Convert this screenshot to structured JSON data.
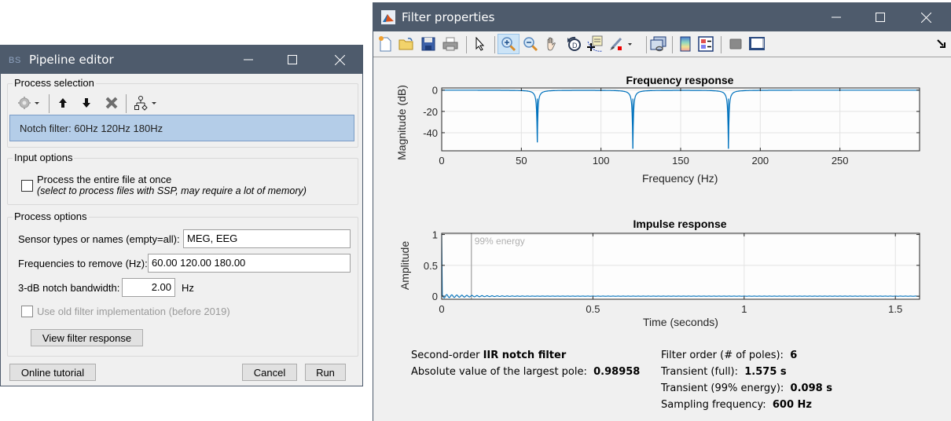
{
  "pipeline_editor": {
    "title": "Pipeline editor",
    "process_selection": {
      "label": "Process selection",
      "toolbar": [
        "gear-menu",
        "move-up",
        "move-down",
        "delete",
        "pipeline-tree"
      ],
      "selected_process": "Notch filter: 60Hz 120Hz 180Hz"
    },
    "input_options": {
      "label": "Input options",
      "entire_file_checkbox": {
        "label": "Process the entire file at once",
        "sublabel": "(select to process files with SSP, may require a lot of memory)",
        "checked": false
      }
    },
    "process_options": {
      "label": "Process options",
      "sensor_types_label": "Sensor types or names (empty=all):",
      "sensor_types_value": "MEG, EEG",
      "frequencies_label": "Frequencies to remove (Hz):",
      "frequencies_value": "60.00 120.00 180.00",
      "bandwidth_label": "3-dB notch bandwidth:",
      "bandwidth_value": "2.00",
      "bandwidth_unit": "Hz",
      "old_filter_checkbox": {
        "label": "Use old filter implementation (before 2019)",
        "checked": false,
        "enabled": false
      },
      "view_response_button": "View filter response"
    },
    "buttons": {
      "online_tutorial": "Online tutorial",
      "cancel": "Cancel",
      "run": "Run"
    }
  },
  "filter_properties": {
    "title": "Filter properties",
    "toolbar": [
      "new-figure",
      "open-file",
      "save",
      "print",
      "select-arrow",
      "zoom-in",
      "zoom-out",
      "pan",
      "rotate",
      "data-cursor",
      "brush",
      "link-plot",
      "colorbar",
      "legend",
      "hide-plot-tools",
      "show-plot-tools",
      "dock"
    ],
    "info": {
      "filter_type_prefix": "Second-order",
      "filter_type_bold": "IIR notch filter",
      "largest_pole_label": "Absolute value of the largest pole:",
      "largest_pole_value": "0.98958",
      "filter_order_label": "Filter order (# of poles):",
      "filter_order_value": "6",
      "transient_full_label": "Transient (full):",
      "transient_full_value": "1.575 s",
      "transient_99_label": "Transient (99% energy):",
      "transient_99_value": "0.098 s",
      "sampling_label": "Sampling frequency:",
      "sampling_value": "600 Hz"
    }
  },
  "chart_data": [
    {
      "type": "line",
      "title": "Frequency response",
      "xlabel": "Frequency (Hz)",
      "ylabel": "Magnitude (dB)",
      "xlim": [
        0,
        300
      ],
      "ylim": [
        -57,
        2
      ],
      "xticks": [
        0,
        50,
        100,
        150,
        200,
        250
      ],
      "yticks": [
        0,
        -20,
        -40
      ],
      "grid": true,
      "series": [
        {
          "name": "magnitude",
          "color": "#0072bd",
          "notches": [
            {
              "freq": 60,
              "depth_db": -49
            },
            {
              "freq": 120,
              "depth_db": -55
            },
            {
              "freq": 180,
              "depth_db": -55
            }
          ],
          "passband_db": 0,
          "bandwidth_hz": 2
        }
      ]
    },
    {
      "type": "line",
      "title": "Impulse response",
      "xlabel": "Time (seconds)",
      "ylabel": "Amplitude",
      "xlim": [
        0,
        1.58
      ],
      "ylim": [
        -0.05,
        1.02
      ],
      "xticks": [
        0,
        0.5,
        1,
        1.5
      ],
      "xtick_labels": [
        "0",
        "0.5",
        "1",
        "1.5"
      ],
      "yticks": [
        0,
        0.5,
        1
      ],
      "ytick_labels": [
        "0",
        "0.5",
        "1"
      ],
      "grid": true,
      "series": [
        {
          "name": "impulse",
          "color": "#0072bd",
          "peak": {
            "t": 0,
            "value": 1
          },
          "ripple_until": 0.3
        }
      ],
      "annotations": [
        {
          "type": "vline",
          "x": 0.098,
          "label": "99% energy",
          "color": "#b0b0b0"
        }
      ]
    }
  ]
}
